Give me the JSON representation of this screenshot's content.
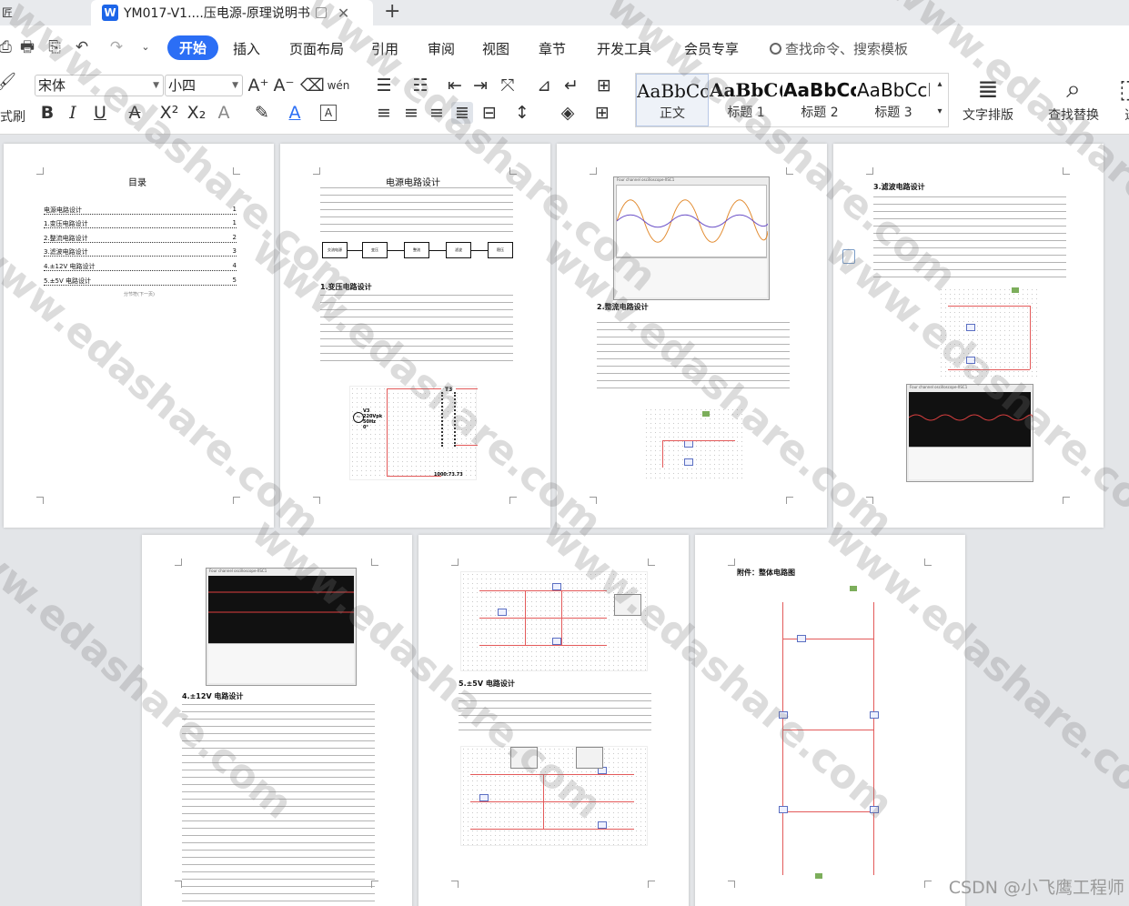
{
  "app": {
    "prev_tab_fragment": "匠",
    "active_tab_title": "YM017-V1....压电源-原理说明书",
    "logo_letter": "W"
  },
  "menu": {
    "items": [
      "开始",
      "插入",
      "页面布局",
      "引用",
      "审阅",
      "视图",
      "章节",
      "开发工具",
      "会员专享"
    ],
    "search_placeholder": "查找命令、搜索模板"
  },
  "ribbon": {
    "format_painter_label": "式刷",
    "font_name": "宋体",
    "font_size": "小四",
    "pinyin_label": "wén",
    "styles": [
      {
        "sample": "AaBbCcI",
        "name": "正文"
      },
      {
        "sample": "AaBbC(",
        "name": "标题 1"
      },
      {
        "sample": "AaBbCc",
        "name": "标题 2"
      },
      {
        "sample": "AaBbCcI",
        "name": "标题 3"
      }
    ],
    "text_layout_label": "文字排版",
    "find_replace_label": "查找替换",
    "cut_label": "选"
  },
  "pages": {
    "p1": {
      "title": "目录",
      "toc": [
        {
          "text": "电源电路设计",
          "page": "1"
        },
        {
          "text": "1.变压电路设计",
          "page": "1"
        },
        {
          "text": "2.整流电路设计",
          "page": "2"
        },
        {
          "text": "3.滤波电路设计",
          "page": "3"
        },
        {
          "text": "4.±12V 电路设计",
          "page": "4"
        },
        {
          "text": "5.±5V 电路设计",
          "page": "5"
        }
      ],
      "section_break": "分节符(下一页)"
    },
    "p2": {
      "title": "电源电路设计",
      "blocks": [
        "交流电源",
        "变压",
        "整流",
        "滤波",
        "稳压"
      ],
      "section1": "1.变压电路设计",
      "source_label": "V3\n220Vpk\n50Hz\n0°",
      "transformer_label": "T3",
      "ratio_label": "1000:73.73"
    },
    "p3": {
      "scope_title": "Four channel oscilloscope-XSC1",
      "section2": "2.整流电路设计"
    },
    "p4": {
      "section3": "3.滤波电路设计",
      "scope_title": "Four channel oscilloscope-XSC1"
    },
    "p5": {
      "scope_title": "Four channel oscilloscope-XSC1",
      "section4": "4.±12V 电路设计"
    },
    "p6": {
      "section5": "5.±5V 电路设计"
    },
    "p7": {
      "title": "附件：整体电路图"
    }
  },
  "watermark": "www.edashare.com",
  "credit": "CSDN @小飞鹰工程师"
}
